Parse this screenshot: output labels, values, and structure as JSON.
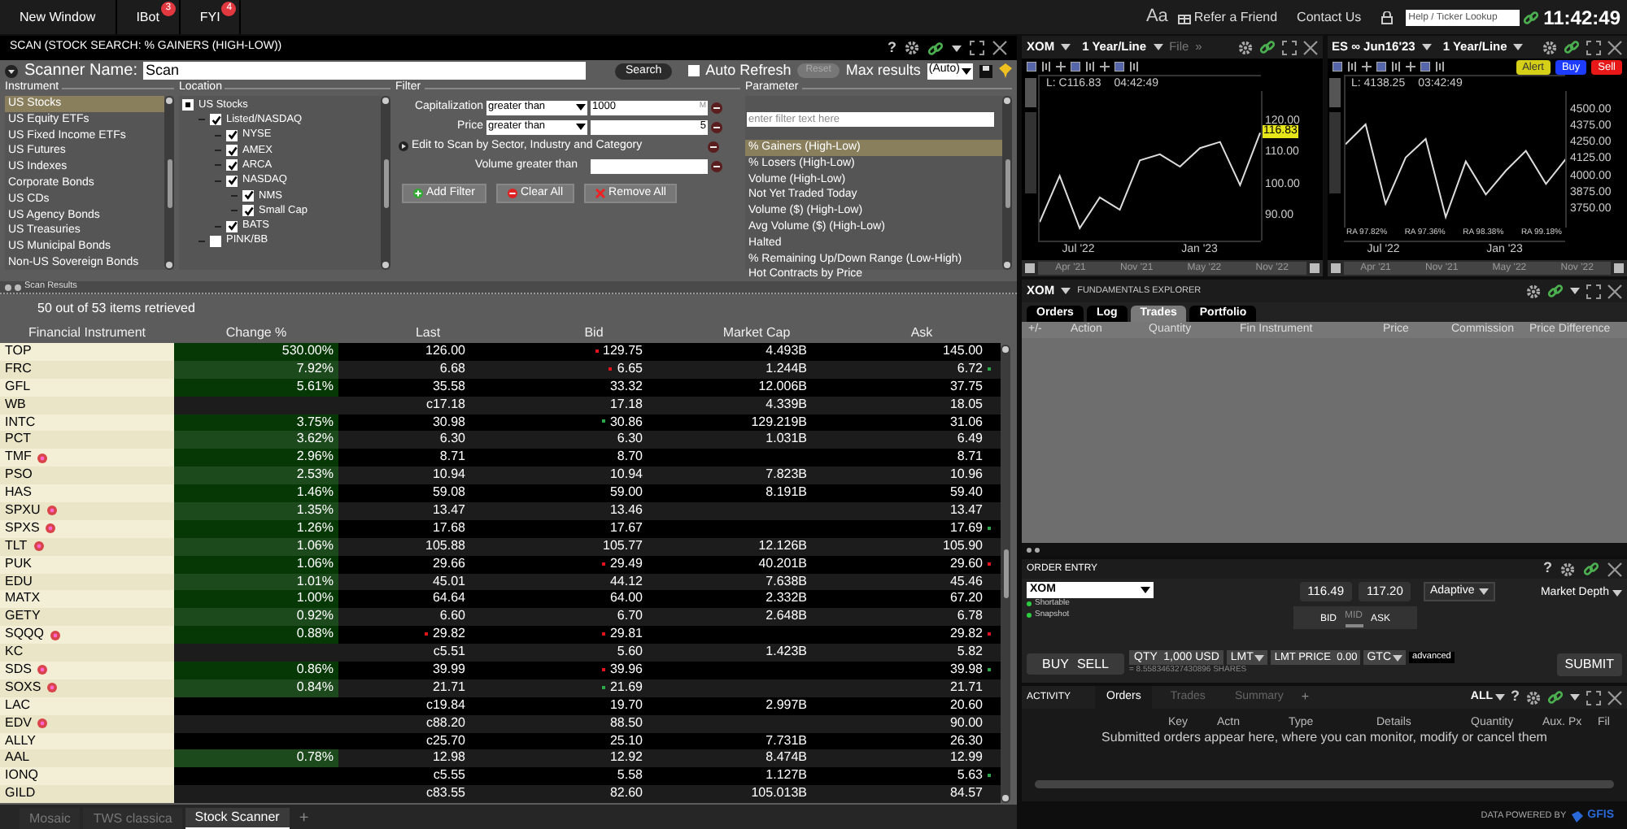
{
  "top_bar": {
    "buttons": [
      {
        "label": "New Window"
      },
      {
        "label": "IBot",
        "badge": "3"
      },
      {
        "label": "FYI",
        "badge": "4"
      }
    ],
    "font_button": "Aa",
    "links": [
      "Refer a Friend",
      "Contact Us"
    ],
    "lookup_placeholder": "Help / Ticker Lookup",
    "clock": "11:42:49"
  },
  "scanner": {
    "title": "SCAN (STOCK SEARCH: % GAINERS (HIGH-LOW))",
    "help": "?",
    "name_label": "Scanner Name:",
    "name_value": "Scan",
    "search_button": "Search",
    "auto_refresh": {
      "label": "Auto Refresh",
      "checked": false
    },
    "reset_button": "Reset",
    "max_results_label": "Max results",
    "max_results_value": "(Auto)",
    "instrument": {
      "heading": "Instrument",
      "items": [
        {
          "label": "US Stocks",
          "selected": true
        },
        {
          "label": "US Equity ETFs",
          "selected": false
        },
        {
          "label": "US Fixed Income ETFs",
          "selected": false
        },
        {
          "label": "US Futures",
          "selected": false
        },
        {
          "label": "US Indexes",
          "selected": false
        },
        {
          "label": "Corporate Bonds",
          "selected": false
        },
        {
          "label": "US CDs",
          "selected": false
        },
        {
          "label": "US Agency Bonds",
          "selected": false
        },
        {
          "label": "US Treasuries",
          "selected": false
        },
        {
          "label": "US Municipal Bonds",
          "selected": false
        },
        {
          "label": "Non-US Sovereign Bonds",
          "selected": false
        }
      ]
    },
    "location": {
      "heading": "Location",
      "tree": [
        {
          "label": "US Stocks",
          "kind": "root",
          "children": [
            {
              "label": "Listed/NASDAQ",
              "kind": "option",
              "checked": true,
              "children": [
                {
                  "label": "NYSE",
                  "kind": "option",
                  "checked": true
                },
                {
                  "label": "AMEX",
                  "kind": "option",
                  "checked": true
                },
                {
                  "label": "ARCA",
                  "kind": "option",
                  "checked": true
                },
                {
                  "label": "NASDAQ",
                  "kind": "option",
                  "checked": true,
                  "children": [
                    {
                      "label": "NMS",
                      "kind": "option",
                      "checked": true
                    },
                    {
                      "label": "Small Cap",
                      "kind": "option",
                      "checked": true
                    }
                  ]
                },
                {
                  "label": "BATS",
                  "kind": "option",
                  "checked": true
                }
              ]
            },
            {
              "label": "PINK/BB",
              "kind": "option",
              "checked": false
            }
          ]
        }
      ]
    },
    "filter": {
      "heading": "Filter",
      "rows": [
        {
          "kind": "select",
          "label": "Capitalization",
          "operator": "greater than",
          "value": "1000",
          "unit": "M"
        },
        {
          "kind": "select",
          "label": "Price",
          "operator": "greater than",
          "value": "5"
        },
        {
          "kind": "expander",
          "label": "Edit to Scan by Sector, Industry and Category"
        },
        {
          "kind": "input",
          "label": "Volume greater than"
        }
      ],
      "buttons": [
        {
          "kind": "add",
          "label": "Add Filter"
        },
        {
          "kind": "clear",
          "label": "Clear All"
        },
        {
          "kind": "remove",
          "label": "Remove All"
        }
      ]
    },
    "parameter": {
      "heading": "Parameter",
      "placeholder": "enter filter text here",
      "items": [
        {
          "label": "% Gainers (High-Low)",
          "selected": true
        },
        {
          "label": "% Losers (High-Low)",
          "selected": false
        },
        {
          "label": "Volume (High-Low)",
          "selected": false
        },
        {
          "label": "Not Yet Traded Today",
          "selected": false
        },
        {
          "label": "Volume ($) (High-Low)",
          "selected": false
        },
        {
          "label": "Avg Volume ($) (High-Low)",
          "selected": false
        },
        {
          "label": "Halted",
          "selected": false
        },
        {
          "label": "% Remaining Up/Down Range (Low-High)",
          "selected": false
        },
        {
          "label": "Hot Contracts by Price",
          "selected": false
        }
      ]
    },
    "results": {
      "label": "Scan Results",
      "summary": "50 out of 53 items retrieved",
      "columns": [
        "Financial Instrument",
        "Change %",
        "Last",
        "Bid",
        "Market Cap",
        "Ask"
      ],
      "rows": [
        {
          "symbol": "TOP",
          "badge": false,
          "change": "530.00%",
          "last": "126.00",
          "bid": "129.75",
          "bid_tick": {
            "color": "#e0141e"
          },
          "market_cap": "4.493B",
          "ask": "145.00"
        },
        {
          "symbol": "FRC",
          "badge": false,
          "change": "7.92%",
          "last": "6.68",
          "bid": "6.65",
          "bid_tick": {
            "color": "#e0141e"
          },
          "market_cap": "1.244B",
          "ask": "6.72",
          "ask_tick": {
            "color": "#2ba84a"
          }
        },
        {
          "symbol": "GFL",
          "badge": false,
          "change": "5.61%",
          "last": "35.58",
          "bid": "33.32",
          "market_cap": "12.006B",
          "ask": "37.75"
        },
        {
          "symbol": "WB",
          "badge": false,
          "last": "c17.18",
          "bid": "17.18",
          "market_cap": "4.339B",
          "ask": "18.05"
        },
        {
          "symbol": "INTC",
          "badge": false,
          "change": "3.75%",
          "last": "30.98",
          "bid": "30.86",
          "bid_tick": {
            "color": "#2ba84a"
          },
          "market_cap": "129.219B",
          "ask": "31.06"
        },
        {
          "symbol": "PCT",
          "badge": false,
          "change": "3.62%",
          "last": "6.30",
          "bid": "6.30",
          "market_cap": "1.031B",
          "ask": "6.49"
        },
        {
          "symbol": "TMF",
          "badge": true,
          "change": "2.96%",
          "last": "8.71",
          "bid": "8.70",
          "ask": "8.71"
        },
        {
          "symbol": "PSO",
          "badge": false,
          "change": "2.53%",
          "last": "10.94",
          "bid": "10.94",
          "market_cap": "7.823B",
          "ask": "10.96"
        },
        {
          "symbol": "HAS",
          "badge": false,
          "change": "1.46%",
          "last": "59.08",
          "bid": "59.00",
          "market_cap": "8.191B",
          "ask": "59.40"
        },
        {
          "symbol": "SPXU",
          "badge": true,
          "change": "1.35%",
          "last": "13.47",
          "bid": "13.46",
          "ask": "13.47"
        },
        {
          "symbol": "SPXS",
          "badge": true,
          "change": "1.26%",
          "last": "17.68",
          "bid": "17.67",
          "ask": "17.69",
          "ask_tick": {
            "color": "#2ba84a"
          }
        },
        {
          "symbol": "TLT",
          "badge": true,
          "change": "1.06%",
          "last": "105.88",
          "bid": "105.77",
          "market_cap": "12.126B",
          "ask": "105.90"
        },
        {
          "symbol": "PUK",
          "badge": false,
          "change": "1.06%",
          "last": "29.66",
          "bid": "29.49",
          "bid_tick": {
            "color": "#e0141e"
          },
          "market_cap": "40.201B",
          "ask": "29.60",
          "ask_tick": {
            "color": "#e0141e"
          }
        },
        {
          "symbol": "EDU",
          "badge": false,
          "change": "1.01%",
          "last": "45.01",
          "bid": "44.12",
          "market_cap": "7.638B",
          "ask": "45.46"
        },
        {
          "symbol": "MATX",
          "badge": false,
          "change": "1.00%",
          "last": "64.64",
          "bid": "64.00",
          "market_cap": "2.332B",
          "ask": "67.20"
        },
        {
          "symbol": "GETY",
          "badge": false,
          "change": "0.92%",
          "last": "6.60",
          "bid": "6.70",
          "market_cap": "2.648B",
          "ask": "6.78"
        },
        {
          "symbol": "SQQQ",
          "badge": true,
          "change": "0.88%",
          "last": "29.82",
          "last_tick": {
            "color": "#e0141e"
          },
          "bid": "29.81",
          "bid_tick": {
            "color": "#e0141e"
          },
          "ask": "29.82",
          "ask_tick": {
            "color": "#e0141e"
          }
        },
        {
          "symbol": "KC",
          "badge": false,
          "last": "c5.51",
          "bid": "5.60",
          "market_cap": "1.423B",
          "ask": "5.82"
        },
        {
          "symbol": "SDS",
          "badge": true,
          "change": "0.86%",
          "last": "39.99",
          "bid": "39.96",
          "bid_tick": {
            "color": "#e0141e"
          },
          "ask": "39.98",
          "ask_tick": {
            "color": "#2ba84a"
          }
        },
        {
          "symbol": "SOXS",
          "badge": true,
          "change": "0.84%",
          "last": "21.71",
          "bid": "21.69",
          "bid_tick": {
            "color": "#2ba84a"
          },
          "ask": "21.71"
        },
        {
          "symbol": "LAC",
          "badge": false,
          "last": "c19.84",
          "bid": "19.70",
          "market_cap": "2.997B",
          "ask": "20.60"
        },
        {
          "symbol": "EDV",
          "badge": true,
          "last": "c88.20",
          "bid": "88.50",
          "ask": "90.00"
        },
        {
          "symbol": "ALLY",
          "badge": false,
          "last": "c25.70",
          "bid": "25.10",
          "market_cap": "7.731B",
          "ask": "26.30"
        },
        {
          "symbol": "AAL",
          "badge": false,
          "change": "0.78%",
          "last": "12.98",
          "bid": "12.92",
          "market_cap": "8.474B",
          "ask": "12.99"
        },
        {
          "symbol": "IONQ",
          "badge": false,
          "last": "c5.55",
          "bid": "5.58",
          "market_cap": "1.127B",
          "ask": "5.63",
          "ask_tick": {
            "color": "#2ba84a"
          }
        },
        {
          "symbol": "GILD",
          "badge": false,
          "last": "c83.55",
          "bid": "82.60",
          "market_cap": "105.013B",
          "ask": "84.57"
        }
      ]
    }
  },
  "bottom_tabs": [
    {
      "label": "Mosaic",
      "selected": false
    },
    {
      "label": "TWS classica",
      "selected": false
    },
    {
      "label": "Stock Scanner",
      "selected": true
    }
  ],
  "add_tab": "+",
  "charts": [
    {
      "symbol": "XOM",
      "period": "1 Year/Line",
      "extra": [
        "File",
        "»"
      ],
      "legend": [
        "L: C116.83",
        "04:42:49"
      ],
      "price_label": "116.83",
      "chart_data": {
        "type": "line",
        "categories": [
          null,
          null,
          "Jul '22",
          null,
          null,
          null,
          null,
          null,
          "Jan '23",
          null,
          null,
          null
        ],
        "ylim": [
          82,
          130
        ],
        "yticks": [
          {
            "value": 120,
            "label": "120.00"
          },
          {
            "value": 110,
            "label": "110.00"
          },
          {
            "value": 100,
            "label": "100.00"
          },
          {
            "value": 90,
            "label": "90.00"
          }
        ],
        "series": [
          {
            "color": "#dddddd",
            "values": [
              88,
              103,
              86,
              96,
              92,
              108,
              110,
              106,
              112,
              114,
              100,
              117
            ]
          }
        ]
      },
      "timeline": [
        "Apr '21",
        "Nov '21",
        "May '22",
        "Nov '22"
      ]
    },
    {
      "symbol": "ES ∞ Jun16'23",
      "period": "1 Year/Line",
      "actions": [
        "Alert",
        "Buy",
        "Sell"
      ],
      "legend": [
        "L: 4138.25",
        "03:42:49"
      ],
      "chart_data": {
        "type": "line",
        "categories": [
          null,
          null,
          "Jul '22",
          null,
          null,
          null,
          null,
          null,
          "Jan '23",
          null,
          null,
          null
        ],
        "ylim": [
          3620,
          4640
        ],
        "yticks": [
          {
            "value": 4500,
            "label": "4500.00"
          },
          {
            "value": 4375,
            "label": "4375.00"
          },
          {
            "value": 4250,
            "label": "4250.00"
          },
          {
            "value": 4125,
            "label": "4125.00"
          },
          {
            "value": 4000,
            "label": "4000.00"
          },
          {
            "value": 3875,
            "label": "3875.00"
          },
          {
            "value": 3750,
            "label": "3750.00"
          }
        ],
        "series": [
          {
            "color": "#dddddd",
            "values": [
              4250,
              4400,
              3800,
              4150,
              4290,
              3700,
              4120,
              3870,
              4050,
              4200,
              3950,
              4140
            ]
          }
        ]
      },
      "ra_labels": [
        "RA 97.82%",
        "RA 97.36%",
        "RA 98.38%",
        "RA 99.18%"
      ],
      "timeline": [
        "Apr '21",
        "Nov '21",
        "May '22",
        "Nov '22"
      ]
    }
  ],
  "fundamentals": {
    "symbol": "XOM",
    "title": "FUNDAMENTALS EXPLORER",
    "tabs": [
      {
        "label": "Orders",
        "selected": false
      },
      {
        "label": "Log",
        "selected": false
      },
      {
        "label": "Trades",
        "selected": true
      },
      {
        "label": "Portfolio",
        "selected": false
      }
    ],
    "columns": [
      "+/-",
      "Action",
      "Quantity",
      "Fin Instrument",
      "Price",
      "Commission",
      "Price Difference"
    ]
  },
  "order_entry": {
    "title": "ORDER ENTRY",
    "help": "?",
    "symbol": "XOM",
    "flags": [
      {
        "label": "Shortable",
        "color": "#2ecc40"
      },
      {
        "label": "Snapshot",
        "color": "#2ecc40"
      }
    ],
    "bid": "116.49",
    "ask": "117.20",
    "scale": [
      {
        "label": "BID",
        "selected": false
      },
      {
        "label": "MID",
        "selected": true
      },
      {
        "label": "ASK",
        "selected": false
      }
    ],
    "algo": "Adaptive",
    "depth": "Market Depth",
    "buy": "BUY",
    "sell": "SELL",
    "qty": "QTY  1,000 USD",
    "order_type": "LMT",
    "limit": "LMT PRICE  0.00",
    "tif": "GTC",
    "advanced": "advanced",
    "shares": "= 8.558346327430896 SHARES",
    "submit": "SUBMIT"
  },
  "activity": {
    "title": "ACTIVITY",
    "tabs": [
      {
        "label": "Orders",
        "selected": true
      },
      {
        "label": "Trades",
        "selected": false
      },
      {
        "label": "Summary",
        "selected": false
      }
    ],
    "add": "+",
    "filter": "ALL",
    "help": "?",
    "columns": [
      "Key",
      "Actn",
      "Type",
      "Details",
      "Quantity",
      "Aux. Px",
      "Fil"
    ],
    "message": "Submitted orders appear here, where you can monitor, modify or cancel them"
  },
  "footer": {
    "text": "DATA POWERED BY",
    "logo": "GFIS"
  }
}
